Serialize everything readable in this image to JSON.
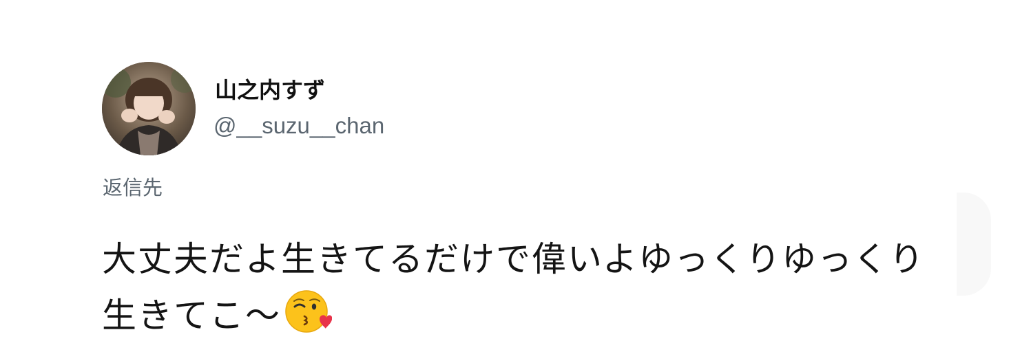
{
  "tweet": {
    "author": {
      "display_name": "山之内すず",
      "handle": "@__suzu__chan"
    },
    "reply_label": "返信先",
    "text": "大丈夫だよ生きてるだけで偉いよゆっくりゆっくり生きてこ〜",
    "emoji": "kissing-face-with-heart-icon"
  }
}
